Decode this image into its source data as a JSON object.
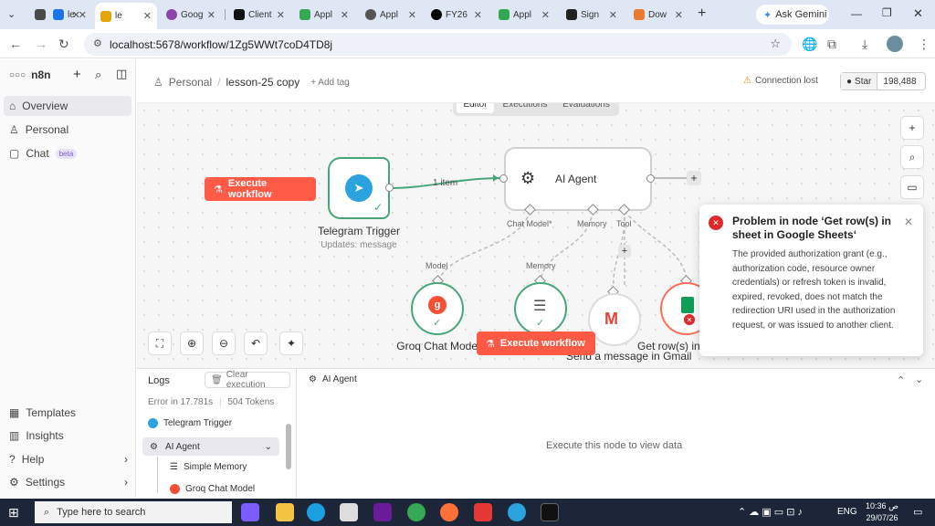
{
  "browser": {
    "tabs": [
      {
        "label": "",
        "color": "#4a4a4a"
      },
      {
        "label": "le",
        "color": "#1a73e8"
      },
      {
        "label": "le",
        "color": "#e5a40a"
      },
      {
        "label": "Goog",
        "color": "#8e44ad"
      },
      {
        "label": "Client",
        "color": "#111111"
      },
      {
        "label": "Appl",
        "color": "#34a853"
      },
      {
        "label": "Appl",
        "color": "#555555"
      },
      {
        "label": "FY26",
        "color": "#000000"
      },
      {
        "label": "Appl",
        "color": "#34a853"
      },
      {
        "label": "Sign",
        "color": "#222222"
      },
      {
        "label": "Dow",
        "color": "#ea7a2f"
      }
    ],
    "new_tab": "+",
    "ask_gemini": "Ask Gemini",
    "url": "localhost:5678/workflow/1Zg5WWt7coD4TD8j"
  },
  "sidebar": {
    "brand": "n8n",
    "items": [
      {
        "label": "Overview",
        "icon": "home-icon"
      },
      {
        "label": "Personal",
        "icon": "user-icon"
      },
      {
        "label": "Chat",
        "icon": "chat-icon"
      }
    ],
    "chat_badge": "beta",
    "bottom_items": [
      {
        "label": "Templates",
        "icon": "templates-icon"
      },
      {
        "label": "Insights",
        "icon": "insights-icon"
      },
      {
        "label": "Help",
        "icon": "help-icon"
      },
      {
        "label": "Settings",
        "icon": "settings-icon"
      }
    ]
  },
  "header": {
    "breadcrumb_owner": "Personal",
    "separator": "/",
    "workflow_name": "lesson-25 copy",
    "add_tag": "+ Add tag",
    "connection_status": "Connection lost",
    "star_label": "Star",
    "star_count": "198,488"
  },
  "view_tabs": [
    "Editor",
    "Executions",
    "Evaluations"
  ],
  "canvas": {
    "execute_label": "Execute workflow",
    "telegram": {
      "title": "Telegram Trigger",
      "subtitle": "Updates: message"
    },
    "edge_label": "1 item",
    "agent": {
      "title": "AI Agent"
    },
    "agent_ports": [
      "Chat Model*",
      "Memory",
      "Tool"
    ],
    "sub_labels": [
      "Model",
      "Memory"
    ],
    "nodes": [
      "Groq Chat Model",
      "Send a message in Gmail",
      "Get row(s) in Google Sheets"
    ]
  },
  "toast": {
    "title": "Problem in node ‘Get row(s) in sheet in Google Sheets‘",
    "message": "The provided authorization grant (e.g., authorization code, resource owner credentials) or refresh token is invalid, expired, revoked, does not match the redirection URI used in the authorization request, or was issued to another client."
  },
  "logs": {
    "title": "Logs",
    "clear_label": "Clear execution",
    "status": "Error in 17.781s",
    "tokens": "504 Tokens",
    "entries": [
      "Telegram Trigger",
      "AI Agent",
      "Simple Memory",
      "Groq Chat Model"
    ],
    "detail_title": "AI Agent",
    "detail_empty": "Execute this node to view data"
  },
  "taskbar": {
    "search_placeholder": "Type here to search",
    "lang": "ENG",
    "time": "10:36 ص",
    "date": "29/07/26"
  },
  "colors": {
    "accent": "#ff5a45",
    "success": "#48a77a",
    "error": "#e0272a"
  }
}
